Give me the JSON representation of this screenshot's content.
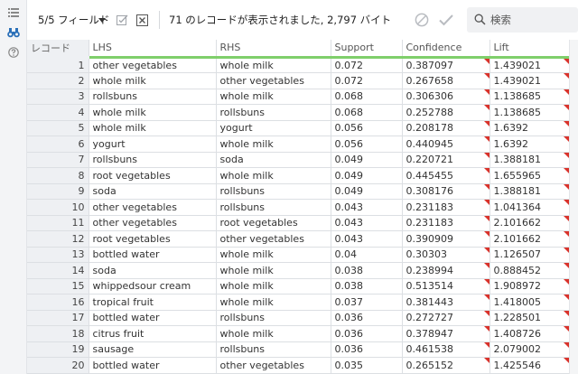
{
  "toolbar": {
    "field_selector": "5/5 フィールド",
    "record_status": "71 のレコードが表示されました, 2,797 バイト",
    "search_placeholder": "検索"
  },
  "grid": {
    "columns": [
      "レコード",
      "LHS",
      "RHS",
      "Support",
      "Confidence",
      "Lift"
    ],
    "rows": [
      [
        "1",
        "other vegetables",
        "whole milk",
        "0.072",
        "0.387097",
        "1.439021"
      ],
      [
        "2",
        "whole milk",
        "other vegetables",
        "0.072",
        "0.267658",
        "1.439021"
      ],
      [
        "3",
        "rollsbuns",
        "whole milk",
        "0.068",
        "0.306306",
        "1.138685"
      ],
      [
        "4",
        "whole milk",
        "rollsbuns",
        "0.068",
        "0.252788",
        "1.138685"
      ],
      [
        "5",
        "whole milk",
        "yogurt",
        "0.056",
        "0.208178",
        "1.6392"
      ],
      [
        "6",
        "yogurt",
        "whole milk",
        "0.056",
        "0.440945",
        "1.6392"
      ],
      [
        "7",
        "rollsbuns",
        "soda",
        "0.049",
        "0.220721",
        "1.388181"
      ],
      [
        "8",
        "root vegetables",
        "whole milk",
        "0.049",
        "0.445455",
        "1.655965"
      ],
      [
        "9",
        "soda",
        "rollsbuns",
        "0.049",
        "0.308176",
        "1.388181"
      ],
      [
        "10",
        "other vegetables",
        "rollsbuns",
        "0.043",
        "0.231183",
        "1.041364"
      ],
      [
        "11",
        "other vegetables",
        "root vegetables",
        "0.043",
        "0.231183",
        "2.101662"
      ],
      [
        "12",
        "root vegetables",
        "other vegetables",
        "0.043",
        "0.390909",
        "2.101662"
      ],
      [
        "13",
        "bottled water",
        "whole milk",
        "0.04",
        "0.30303",
        "1.126507"
      ],
      [
        "14",
        "soda",
        "whole milk",
        "0.038",
        "0.238994",
        "0.888452"
      ],
      [
        "15",
        "whippedsour cream",
        "whole milk",
        "0.038",
        "0.513514",
        "1.908972"
      ],
      [
        "16",
        "tropical fruit",
        "whole milk",
        "0.037",
        "0.381443",
        "1.418005"
      ],
      [
        "17",
        "bottled water",
        "rollsbuns",
        "0.036",
        "0.272727",
        "1.228501"
      ],
      [
        "18",
        "citrus fruit",
        "whole milk",
        "0.036",
        "0.378947",
        "1.408726"
      ],
      [
        "19",
        "sausage",
        "rollsbuns",
        "0.036",
        "0.461538",
        "2.079002"
      ],
      [
        "20",
        "bottled water",
        "other vegetables",
        "0.035",
        "0.265152",
        "1.425546"
      ]
    ]
  },
  "colors": {
    "header_underline": "#7fcf6b",
    "cell_flag": "#d9322b",
    "binoculars_active": "#2a6fb8"
  },
  "icons": {
    "rail": [
      "list-icon",
      "binoculars-icon",
      "help-icon"
    ],
    "toolbar": [
      "dropdown-caret-icon",
      "checkbox-edit-icon",
      "close-box-icon",
      "cancel-icon",
      "check-icon",
      "search-icon"
    ]
  }
}
